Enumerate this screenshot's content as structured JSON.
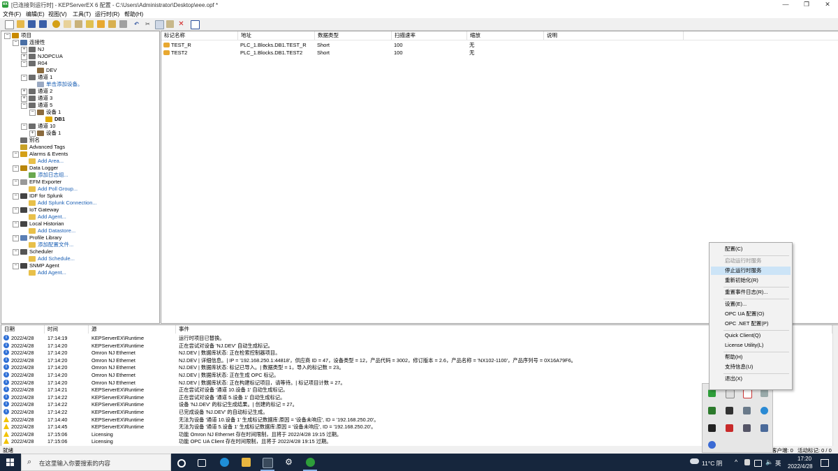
{
  "window": {
    "title": "[已连接到运行时] - KEPServerEX 6 配置 - C:\\Users\\Administrator\\Desktop\\eee.opf *",
    "app_icon_text": "ex"
  },
  "menu": [
    "文件(F)",
    "编辑(E)",
    "视图(V)",
    "工具(T)",
    "运行时(R)",
    "帮助(H)"
  ],
  "tree": [
    {
      "label": "项目",
      "indent": 0,
      "exp": "⊟",
      "icon": "#c98a00",
      "link": false
    },
    {
      "label": "连接性",
      "indent": 1,
      "exp": "⊟",
      "icon": "#4a6fa5",
      "link": false
    },
    {
      "label": "NJ",
      "indent": 2,
      "exp": "⊞",
      "icon": "#6c6c6c",
      "link": false
    },
    {
      "label": "NJOPCUA",
      "indent": 2,
      "exp": "⊞",
      "icon": "#6c6c6c",
      "link": false
    },
    {
      "label": "R04",
      "indent": 2,
      "exp": "⊟",
      "icon": "#6c6c6c",
      "link": false
    },
    {
      "label": "DEV",
      "indent": 3,
      "exp": "",
      "icon": "#8b6b3e",
      "link": false
    },
    {
      "label": "通道 1",
      "indent": 2,
      "exp": "⊟",
      "icon": "#6c6c6c",
      "link": false
    },
    {
      "label": "单击添加设备。",
      "indent": 3,
      "exp": "",
      "icon": "#9aa9c2",
      "link": true
    },
    {
      "label": "通道 2",
      "indent": 2,
      "exp": "⊞",
      "icon": "#6c6c6c",
      "link": false
    },
    {
      "label": "通道 3",
      "indent": 2,
      "exp": "⊞",
      "icon": "#6c6c6c",
      "link": false
    },
    {
      "label": "通道 5",
      "indent": 2,
      "exp": "⊟",
      "icon": "#6c6c6c",
      "link": false
    },
    {
      "label": "设备 1",
      "indent": 3,
      "exp": "⊟",
      "icon": "#8b6b3e",
      "link": false
    },
    {
      "label": "DB1",
      "indent": 4,
      "exp": "",
      "icon": "#e0a800",
      "link": false,
      "bold": true
    },
    {
      "label": "通道 10",
      "indent": 2,
      "exp": "⊟",
      "icon": "#6c6c6c",
      "link": false
    },
    {
      "label": "设备 1",
      "indent": 3,
      "exp": "⊞",
      "icon": "#8b6b3e",
      "link": false
    },
    {
      "label": "别名",
      "indent": 1,
      "exp": "",
      "icon": "#6c6c6c",
      "link": false
    },
    {
      "label": "Advanced Tags",
      "indent": 1,
      "exp": "",
      "icon": "#c9a227",
      "link": false
    },
    {
      "label": "Alarms & Events",
      "indent": 1,
      "exp": "⊟",
      "icon": "#d4a017",
      "link": false
    },
    {
      "label": "Add Area...",
      "indent": 2,
      "exp": "",
      "icon": "#e8c04a",
      "link": true
    },
    {
      "label": "Data Logger",
      "indent": 1,
      "exp": "⊟",
      "icon": "#b8860b",
      "link": false
    },
    {
      "label": "添加日志组...",
      "indent": 2,
      "exp": "",
      "icon": "#6aa84f",
      "link": true
    },
    {
      "label": "EFM Exporter",
      "indent": 1,
      "exp": "⊟",
      "icon": "#999999",
      "link": false
    },
    {
      "label": "Add Poll Group...",
      "indent": 2,
      "exp": "",
      "icon": "#e8c04a",
      "link": true
    },
    {
      "label": "IDF for Splunk",
      "indent": 1,
      "exp": "⊟",
      "icon": "#444444",
      "link": false
    },
    {
      "label": "Add Splunk Connection...",
      "indent": 2,
      "exp": "",
      "icon": "#e8c04a",
      "link": true
    },
    {
      "label": "IoT Gateway",
      "indent": 1,
      "exp": "⊟",
      "icon": "#444444",
      "link": false
    },
    {
      "label": "Add Agent...",
      "indent": 2,
      "exp": "",
      "icon": "#e8c04a",
      "link": true
    },
    {
      "label": "Local Historian",
      "indent": 1,
      "exp": "⊟",
      "icon": "#444444",
      "link": false
    },
    {
      "label": "Add Datastore...",
      "indent": 2,
      "exp": "",
      "icon": "#e8c04a",
      "link": true
    },
    {
      "label": "Profile Library",
      "indent": 1,
      "exp": "⊟",
      "icon": "#5b7fb5",
      "link": false
    },
    {
      "label": "添加配置文件...",
      "indent": 2,
      "exp": "",
      "icon": "#e8c04a",
      "link": true
    },
    {
      "label": "Scheduler",
      "indent": 1,
      "exp": "⊟",
      "icon": "#555555",
      "link": false
    },
    {
      "label": "Add Schedule...",
      "indent": 2,
      "exp": "",
      "icon": "#e8c04a",
      "link": true
    },
    {
      "label": "SNMP Agent",
      "indent": 1,
      "exp": "⊟",
      "icon": "#444444",
      "link": false
    },
    {
      "label": "Add Agent...",
      "indent": 2,
      "exp": "",
      "icon": "#e8c04a",
      "link": true
    }
  ],
  "tags": {
    "columns": [
      "标记名称",
      "地址",
      "数据类型",
      "扫描速率",
      "缩放",
      "说明"
    ],
    "rows": [
      {
        "name": "TEST_R",
        "address": "PLC_1.Blocks.DB1.TEST_R",
        "type": "Short",
        "rate": "100",
        "scaling": "无",
        "desc": ""
      },
      {
        "name": "TEST2",
        "address": "PLC_1.Blocks.DB1.TEST2",
        "type": "Short",
        "rate": "100",
        "scaling": "无",
        "desc": ""
      }
    ]
  },
  "events": {
    "columns": [
      "日期",
      "时间",
      "源",
      "事件"
    ],
    "rows": [
      {
        "level": "info",
        "date": "2022/4/28",
        "time": "17:14:19",
        "source": "KEPServerEX\\Runtime",
        "event": "运行时项目已替换。"
      },
      {
        "level": "info",
        "date": "2022/4/28",
        "time": "17:14:20",
        "source": "KEPServerEX\\Runtime",
        "event": "正在尝试对设备 'NJ.DEV' 自动生成标记。"
      },
      {
        "level": "info",
        "date": "2022/4/28",
        "time": "17:14:20",
        "source": "Omron NJ Ethernet",
        "event": "NJ.DEV | 数据库状态: 正在检索控制器项目。"
      },
      {
        "level": "info",
        "date": "2022/4/28",
        "time": "17:14:20",
        "source": "Omron NJ Ethernet",
        "event": "NJ.DEV | 详细信息。| IP = '192.168.250.1:44818'，供应商 ID = 47，设备类型 = 12，产品代码 = 3002，修订版本 = 2.6，产品名称 = 'NX102-1100'，产品序列号 = 0X16A79F6。"
      },
      {
        "level": "info",
        "date": "2022/4/28",
        "time": "17:14:20",
        "source": "Omron NJ Ethernet",
        "event": "NJ.DEV | 数据库状态: 标记已导入。| 数据类型 = 1，导入的标记数 = 23。"
      },
      {
        "level": "info",
        "date": "2022/4/28",
        "time": "17:14:20",
        "source": "Omron NJ Ethernet",
        "event": "NJ.DEV | 数据库状态: 正在生成 OPC 标记。"
      },
      {
        "level": "info",
        "date": "2022/4/28",
        "time": "17:14:20",
        "source": "Omron NJ Ethernet",
        "event": "NJ.DEV | 数据库状态: 正在构建标记项目，请等待。| 标记项目计数 = 27。"
      },
      {
        "level": "info",
        "date": "2022/4/28",
        "time": "17:14:21",
        "source": "KEPServerEX\\Runtime",
        "event": "正在尝试对设备 '通道 10.设备 1' 自动生成标记。"
      },
      {
        "level": "info",
        "date": "2022/4/28",
        "time": "17:14:22",
        "source": "KEPServerEX\\Runtime",
        "event": "正在尝试对设备 '通道 5.设备 1' 自动生成标记。"
      },
      {
        "level": "info",
        "date": "2022/4/28",
        "time": "17:14:22",
        "source": "KEPServerEX\\Runtime",
        "event": "设备 'NJ.DEV' 的标记生成结果。| 创建的标记 = 27。"
      },
      {
        "level": "info",
        "date": "2022/4/28",
        "time": "17:14:22",
        "source": "KEPServerEX\\Runtime",
        "event": "已完成设备 'NJ.DEV' 的自动标记生成。"
      },
      {
        "level": "warn",
        "date": "2022/4/28",
        "time": "17:14:40",
        "source": "KEPServerEX\\Runtime",
        "event": "无法为设备 '通道 10.设备 1' 生成标记数据库:原因 = '设备未响应', ID = '192.168.250.20'。"
      },
      {
        "level": "warn",
        "date": "2022/4/28",
        "time": "17:14:45",
        "source": "KEPServerEX\\Runtime",
        "event": "无法为设备 '通道 5.设备 1' 生成标记数据库:原因 = '设备未响应', ID = '192.168.250.20'。"
      },
      {
        "level": "warn",
        "date": "2022/4/28",
        "time": "17:15:06",
        "source": "Licensing",
        "event": "功能 Omron NJ Ethernet 存在时间限制，且将于 2022/4/28 19:15 过期。"
      },
      {
        "level": "warn",
        "date": "2022/4/28",
        "time": "17:15:06",
        "source": "Licensing",
        "event": "功能 OPC UA Client 存在时间限制，且将于 2022/4/28 19:15 过期。"
      }
    ]
  },
  "status": {
    "left": "就绪",
    "clients": "客户端: 0",
    "active_tags": "活动标记: 0 / 0"
  },
  "context_menu": [
    {
      "label": "配置(C)",
      "disabled": false
    },
    {
      "sep": true
    },
    {
      "label": "启动运行时服务",
      "disabled": true
    },
    {
      "label": "停止运行时服务",
      "disabled": false,
      "highlight": true
    },
    {
      "label": "重新初始化(R)",
      "disabled": false
    },
    {
      "sep": true
    },
    {
      "label": "重置事件日志(R)...",
      "disabled": false
    },
    {
      "sep": true
    },
    {
      "label": "设置(E)...",
      "disabled": false
    },
    {
      "label": "OPC UA 配置(O)",
      "disabled": false
    },
    {
      "label": "OPC .NET 配置(P)",
      "disabled": false
    },
    {
      "sep": true
    },
    {
      "label": "Quick Client(Q)",
      "disabled": false
    },
    {
      "label": "License Utility(L)",
      "disabled": false
    },
    {
      "sep": true
    },
    {
      "label": "帮助(H)",
      "disabled": false
    },
    {
      "label": "支持信息(U)",
      "disabled": false
    },
    {
      "sep": true
    },
    {
      "label": "退出(X)",
      "disabled": false
    }
  ],
  "taskbar": {
    "search_placeholder": "在这里输入你要搜索的内容",
    "weather": "11°C 阴",
    "ime": "英",
    "time": "17:20",
    "date": "2022/4/28"
  },
  "colors": {
    "accent": "#cce4f7",
    "taskbar": "#16263d",
    "link": "#1a5fb4"
  }
}
